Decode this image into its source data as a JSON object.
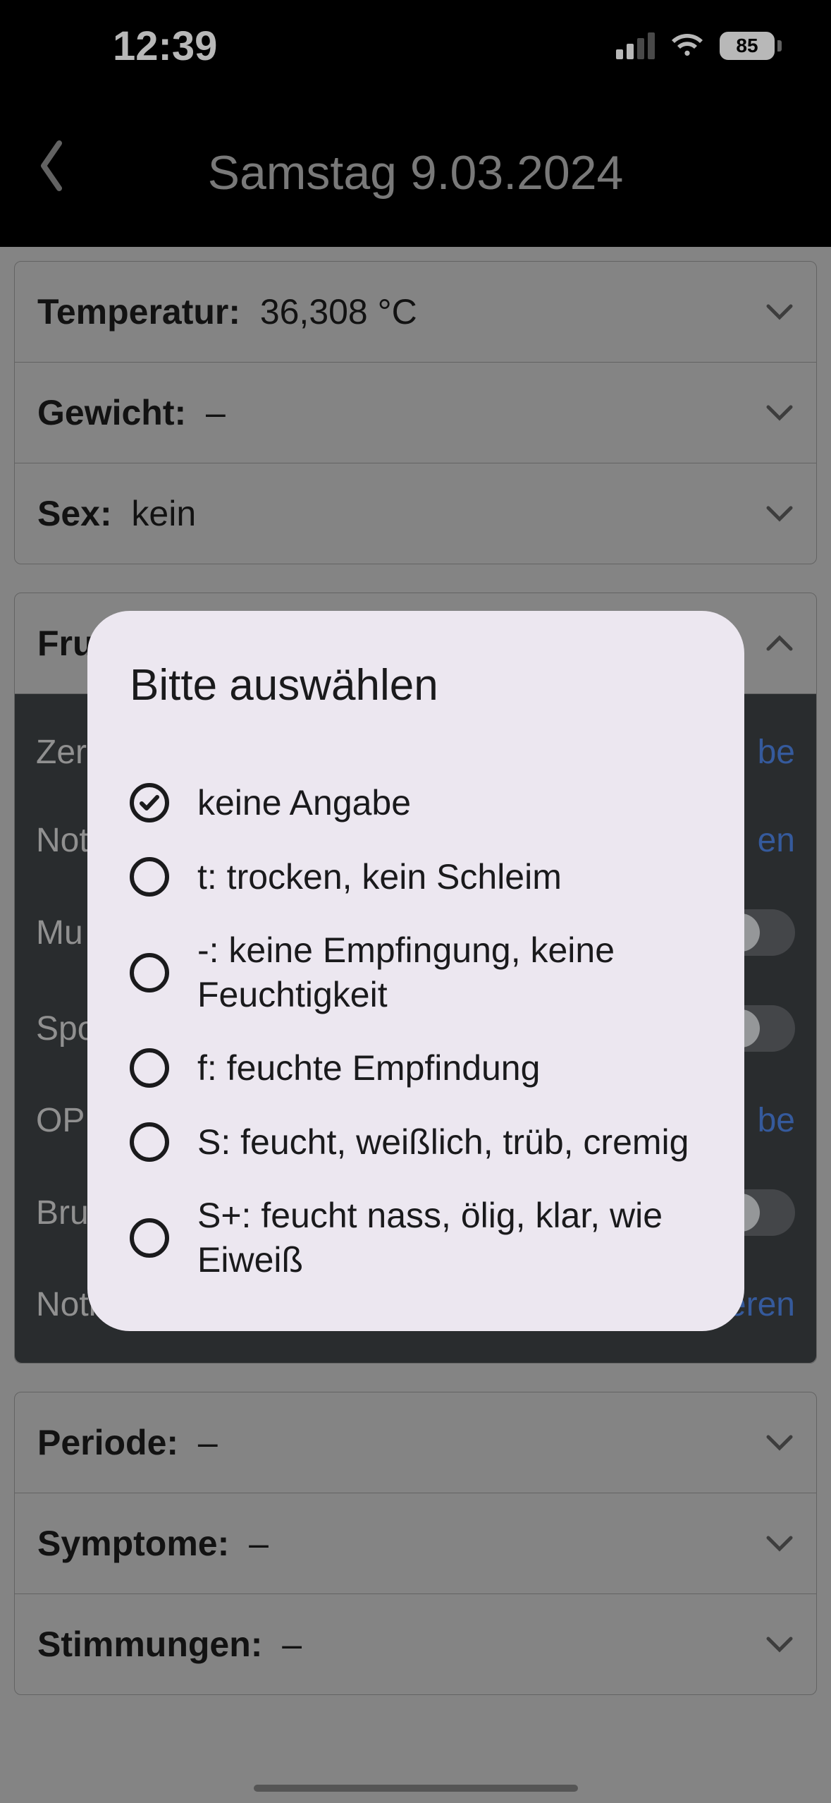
{
  "status": {
    "time": "12:39",
    "battery_pct": "85"
  },
  "nav": {
    "title": "Samstag 9.03.2024"
  },
  "rows": {
    "temp_label": "Temperatur:",
    "temp_value": "36,308 °C",
    "weight_label": "Gewicht:",
    "weight_value": "–",
    "sex_label": "Sex:",
    "sex_value": "kein",
    "fru_label": "Fru",
    "period_label": "Periode:",
    "period_value": "–",
    "symptom_label": "Symptome:",
    "symptom_value": "–",
    "mood_label": "Stimmungen:",
    "mood_value": "–"
  },
  "dark": {
    "zer_label": "Zer",
    "zer_link_suffix": "be",
    "not_label": "Not",
    "not_link_suffix": "en",
    "mu_label": "Mu",
    "spo_label": "Spo",
    "opk_label": "OPK",
    "opk_link_suffix": "be",
    "brust_label": "Brust",
    "notes_label": "Notizen zur Brustabtastung",
    "notes_link": "editieren"
  },
  "modal": {
    "title": "Bitte auswählen",
    "options": [
      "keine Angabe",
      "t: trocken, kein Schleim",
      "-: keine Empfingung, keine Feuchtigkeit",
      "f: feuchte Empfindung",
      "S: feucht, weißlich, trüb, cremig",
      "S+: feucht nass, ölig, klar, wie Eiweiß"
    ],
    "selected_index": 0
  }
}
